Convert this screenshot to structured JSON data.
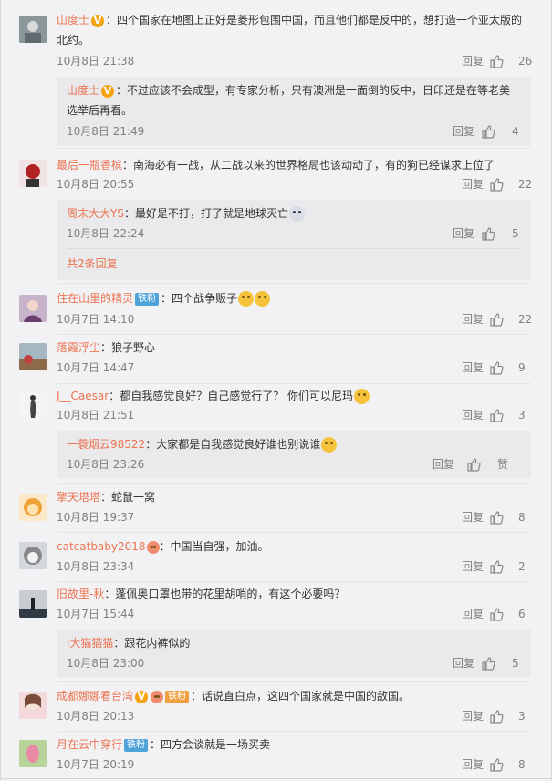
{
  "ui": {
    "reply_label": "回复",
    "like_zan_label": "赞",
    "more_replies": "共2条回复",
    "badge_fans": "铁粉",
    "colors": {
      "username": "#eb7350",
      "meta": "#808080",
      "text": "#333333",
      "badge": "#4fa3d9",
      "vip": "#f3a40f"
    }
  },
  "comments": [
    {
      "user": "山度士",
      "text": "：四个国家在地图上正好是菱形包围中国，而且他们都是反中的，想打造一个亚太版的北约。",
      "time": "10月8日 21:38",
      "likes": "26",
      "reply": {
        "user": "山度士",
        "text": "：不过应该不会成型，有专家分析，只有澳洲是一面倒的反中，日印还是在等老美选举后再看。",
        "time": "10月8日 21:49",
        "likes": "4"
      }
    },
    {
      "user": "最后一瓶香槟",
      "text": "：南海必有一战，从二战以来的世界格局也该动动了，有的狗已经谋求上位了",
      "time": "10月8日 20:55",
      "likes": "22",
      "reply": {
        "user": "周末大大YS",
        "text": "：最好是不打，打了就是地球灭亡",
        "time": "10月8日 22:24",
        "likes": "5"
      }
    },
    {
      "user": "住在山里的精灵",
      "text": "：四个战争贩子",
      "time": "10月7日 14:10",
      "likes": "22"
    },
    {
      "user": "落霞浮尘",
      "text": "：狼子野心",
      "time": "10月7日 14:47",
      "likes": "9"
    },
    {
      "user": "J__Caesar",
      "text": "：都自我感觉良好？自己感觉行了？ 你们可以尼玛",
      "time": "10月8日 21:51",
      "likes": "3",
      "reply": {
        "user": "一蓑烟云98522",
        "text": "：大家都是自我感觉良好谁也别说谁",
        "time": "10月8日 23:26",
        "likes": ""
      }
    },
    {
      "user": "擎天塔塔",
      "text": "：蛇鼠一窝",
      "time": "10月8日 19:37",
      "likes": "8"
    },
    {
      "user": "catcatbaby2018",
      "text": "：中国当自强，加油。",
      "time": "10月8日 23:34",
      "likes": "2"
    },
    {
      "user": "旧故里-秋",
      "text": "：蓬佩奥口罩也带的花里胡哨的，有这个必要吗？",
      "time": "10月7日 15:44",
      "likes": "6",
      "reply": {
        "user": "i大猫猫猫",
        "text": "：跟花内裤似的",
        "time": "10月8日 23:00",
        "likes": "5"
      }
    },
    {
      "user": "成都娜娜看台湾",
      "text": "：话说直白点，这四个国家就是中国的敌国。",
      "time": "10月8日 20:13",
      "likes": "3"
    },
    {
      "user": "月在云中穿行",
      "text": "：四方会谈就是一场买卖",
      "time": "10月7日 20:19",
      "likes": "8"
    }
  ]
}
